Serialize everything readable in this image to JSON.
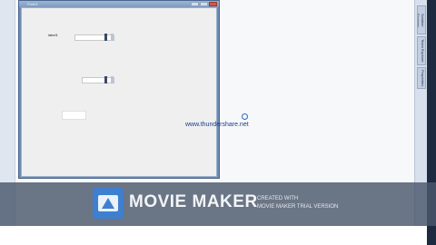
{
  "ide": {
    "right_tabs": [
      "Solution Explorer",
      "Team Explorer",
      "Properties"
    ]
  },
  "form": {
    "title": "Form1",
    "label1": "label1"
  },
  "overlay": {
    "url": "www.thundershare.net"
  },
  "banner": {
    "title": "MOVIE MAKER",
    "subtitle1": "CREATED WITH",
    "subtitle2": "MOVIE MAKER TRIAL VERSION"
  },
  "colors": {
    "banner_bg": "#4a586c",
    "logo": "#3f7fcf",
    "window_frame": "#6b8cb5"
  }
}
